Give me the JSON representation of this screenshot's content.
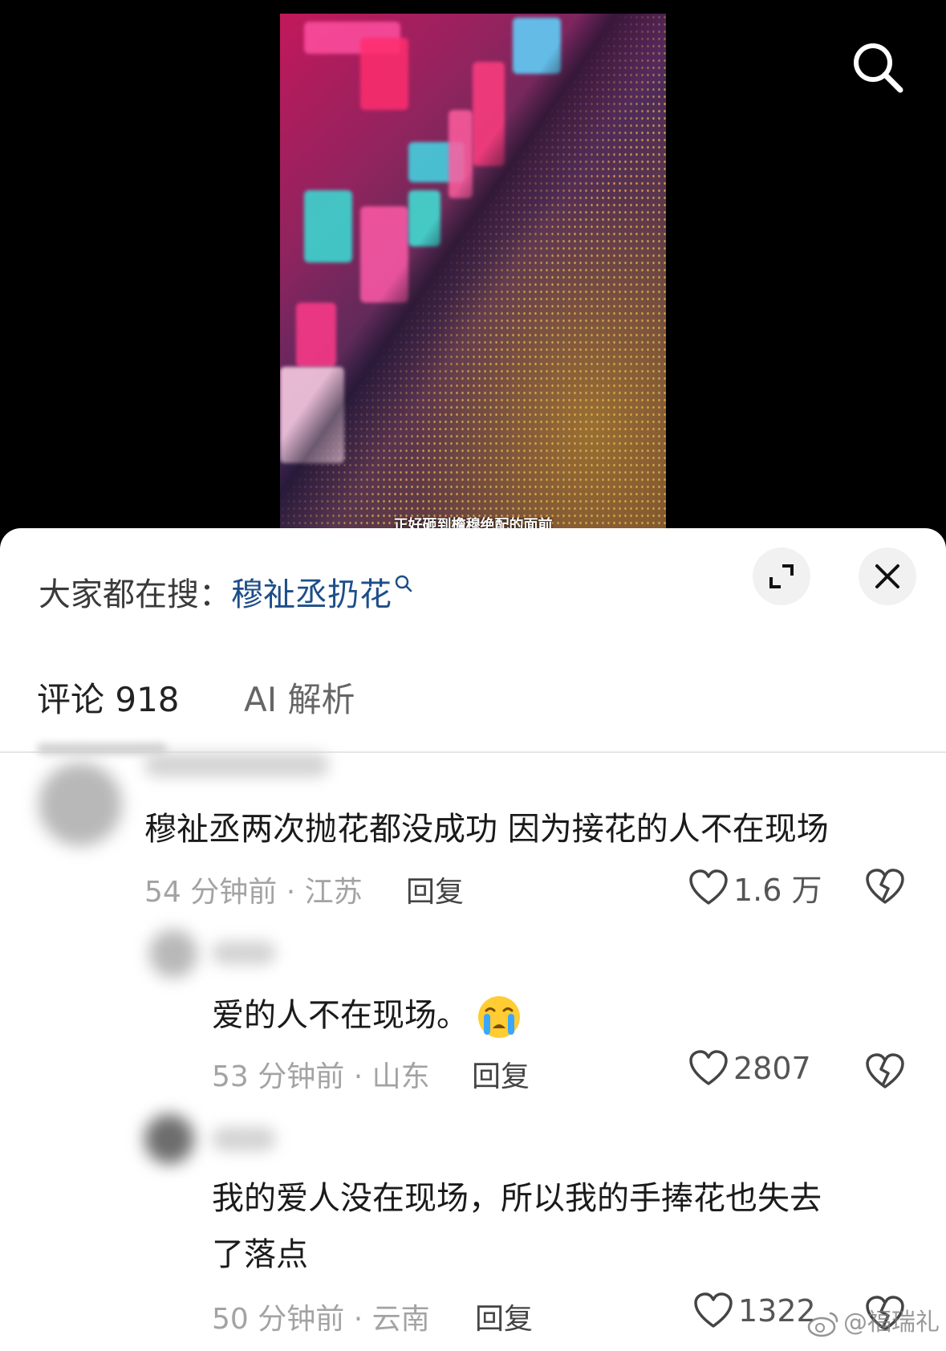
{
  "video": {
    "caption": "正好砸到檐穆绝配的面前"
  },
  "search_bar": {
    "prefix": "大家都在搜：",
    "term": "穆祉丞扔花"
  },
  "tabs": {
    "comments_label": "评论 918",
    "ai_label": "AI 解析"
  },
  "comments": [
    {
      "text": "穆祉丞两次抛花都没成功 因为接花的人不在现场",
      "meta": "54 分钟前 · 江苏",
      "reply_label": "回复",
      "likes": "1.6 万"
    },
    {
      "text": "爱的人不在现场。",
      "emoji": "crying-face",
      "meta": "53 分钟前 · 山东",
      "reply_label": "回复",
      "likes": "2807"
    },
    {
      "text_line1": "我的爱人没在现场，所以我的手捧花也失去",
      "text_line2": "了落点",
      "meta": "50 分钟前 · 云南",
      "reply_label": "回复",
      "likes": "1322"
    }
  ],
  "watermark": "@福瑞礼",
  "icons": [
    "search-icon",
    "expand-icon",
    "close-icon",
    "heart-icon",
    "broken-heart-icon",
    "crying-face-icon",
    "weibo-logo-icon"
  ],
  "colors": {
    "link_blue": "#1d4e89",
    "meta_gray": "#a3a3a3",
    "sheet_bg": "#ffffff"
  }
}
